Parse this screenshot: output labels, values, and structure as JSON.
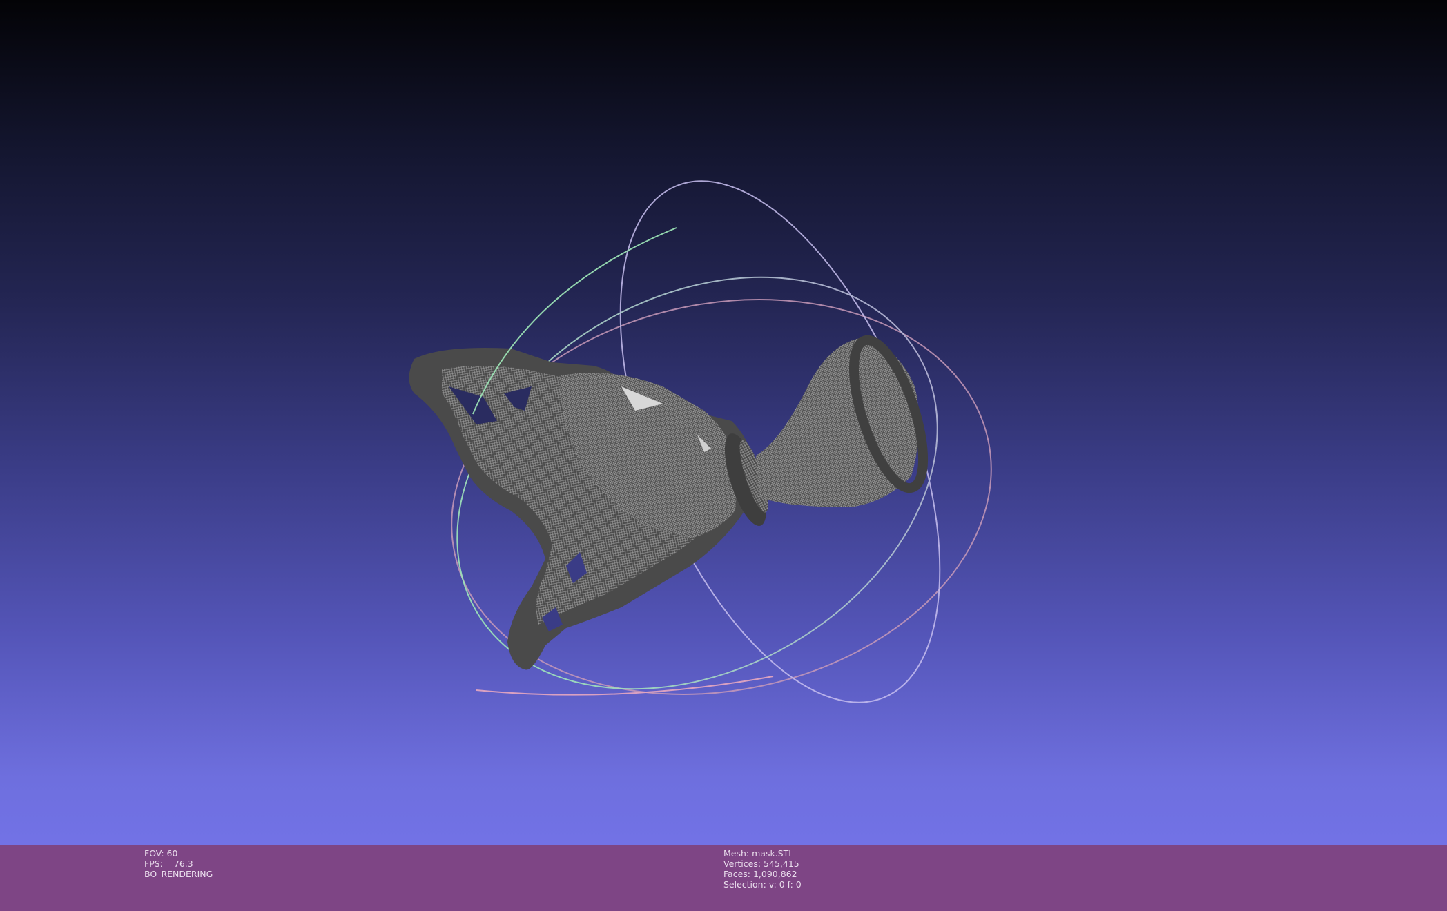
{
  "viewer": {
    "background_top": "#030306",
    "background_bottom": "#7272e6",
    "status_bar_color": "#7e4585",
    "trackball_colors": {
      "x_ring": "#9ee8b8",
      "y_ring": "#e8b0c8",
      "z_ring": "#c8c0f0"
    },
    "mesh_color": "#555555"
  },
  "status_left": {
    "fov_label": "FOV:",
    "fov_value": "60",
    "fps_label": "FPS:",
    "fps_value": "76.3",
    "render_mode": "BO_RENDERING"
  },
  "status_right": {
    "mesh_line": "Mesh: mask.STL",
    "vertices_line": "Vertices: 545,415",
    "faces_line": "Faces: 1,090,862",
    "selection_line": "Selection: v: 0 f: 0"
  }
}
